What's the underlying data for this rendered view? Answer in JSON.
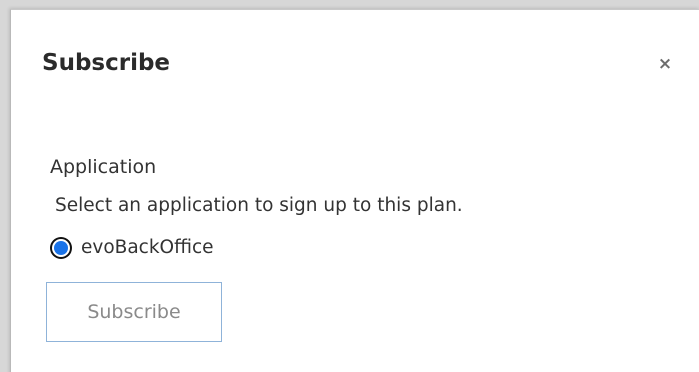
{
  "dialog": {
    "title": "Subscribe",
    "close_label": "×"
  },
  "application": {
    "section_label": "Application",
    "help_text": "Select an application to sign up to this plan.",
    "options": [
      {
        "label": "evoBackOffice",
        "selected": true
      }
    ]
  },
  "actions": {
    "subscribe_label": "Subscribe",
    "subscribe_disabled": true
  },
  "colors": {
    "radio_selected": "#1a73e8",
    "button_border": "#8fb3d9",
    "button_text_disabled": "#8a8a8a"
  }
}
